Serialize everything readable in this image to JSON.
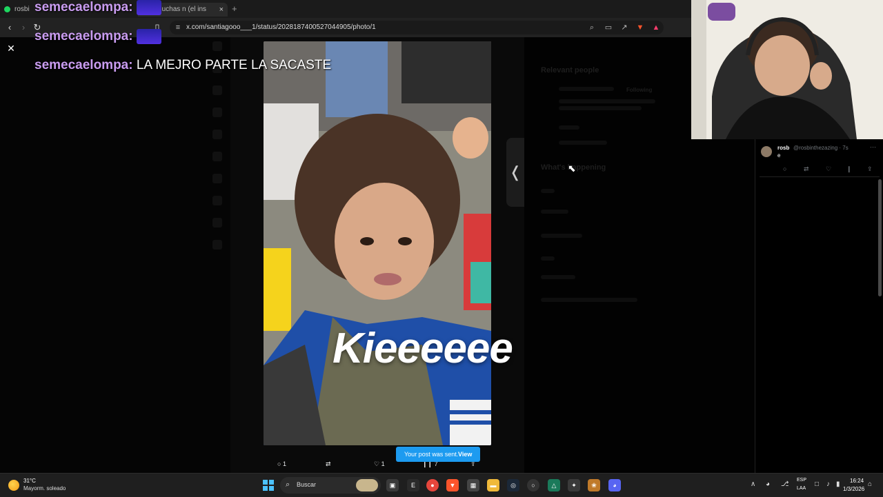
{
  "browser": {
    "tab1_title": "rosbi p",
    "tab2_title": "nn... muchas n (el ins",
    "tab_close": "×",
    "new_tab": "+",
    "url": "x.com/santiagooo___1/status/2028187400527044905/photo/1"
  },
  "chat": [
    {
      "user": "semecaelompa:",
      "message": ""
    },
    {
      "user": "semecaelompa:",
      "message": ""
    },
    {
      "user": "semecaelompa:",
      "message": "LA MEJRO PARTE LA SACASTE"
    }
  ],
  "photo": {
    "caption": "Kieeeeee"
  },
  "background_panel": {
    "relevant_people": "Relevant people",
    "follow": "Following",
    "whats_happening": "What's happening"
  },
  "actions": {
    "replies": "1",
    "likes": "1",
    "views": "7"
  },
  "toast": {
    "text": "Your post was sent.",
    "view": "View"
  },
  "reply": {
    "name": "rosb",
    "handle": "@rosbinthezazing · 7s",
    "body": "e"
  },
  "taskbar": {
    "weather_temp": "31°C",
    "weather_desc": "Mayorm. soleado",
    "search_label": "Buscar",
    "lang_line1": "ESP",
    "lang_line2": "LAA",
    "time": "16:24",
    "date": "1/3/2026"
  },
  "colors": {
    "accent_blue": "#1d9bf0",
    "chat_username": "#c99cf0",
    "start_blue": "#4cc2ff"
  }
}
